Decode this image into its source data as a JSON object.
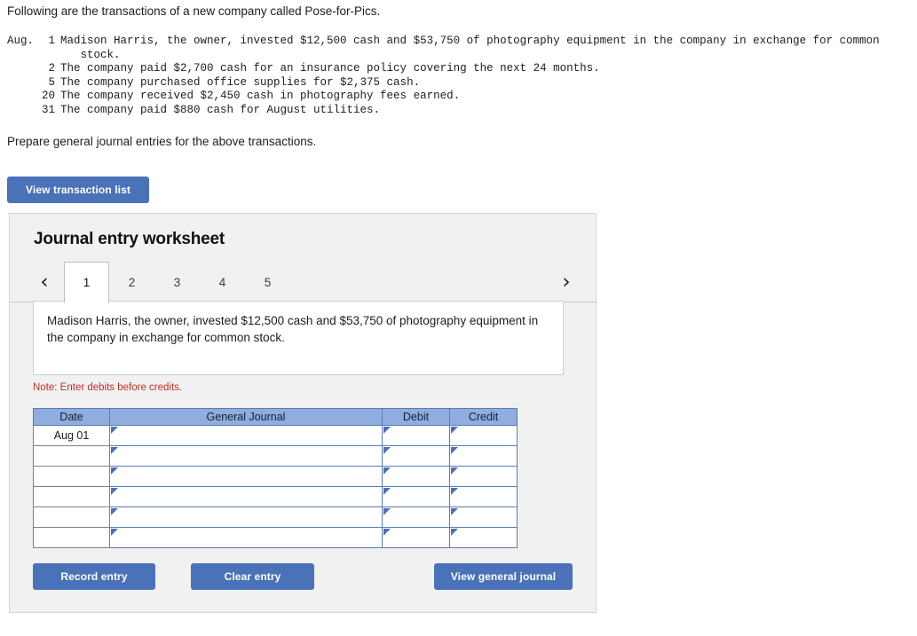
{
  "problem": {
    "intro": "Following are the transactions of a new company called Pose-for-Pics.",
    "month_label": "Aug.",
    "transactions": [
      {
        "day": "1",
        "description": "Madison Harris, the owner, invested $12,500 cash and $53,750 of photography equipment in the company in exchange for common\n   stock."
      },
      {
        "day": "2",
        "description": "The company paid $2,700 cash for an insurance policy covering the next 24 months."
      },
      {
        "day": "5",
        "description": "The company purchased office supplies for $2,375 cash."
      },
      {
        "day": "20",
        "description": "The company received $2,450 cash in photography fees earned."
      },
      {
        "day": "31",
        "description": "The company paid $880 cash for August utilities."
      }
    ],
    "instruction": "Prepare general journal entries for the above transactions."
  },
  "toolbar": {
    "view_transaction_list_label": "View transaction list"
  },
  "worksheet": {
    "title": "Journal entry worksheet",
    "prev_icon": "chevron-left-icon",
    "next_icon": "chevron-right-icon",
    "prev_glyph": "‹",
    "next_glyph": "›",
    "tabs": [
      {
        "label": "1",
        "active": true
      },
      {
        "label": "2",
        "active": false
      },
      {
        "label": "3",
        "active": false
      },
      {
        "label": "4",
        "active": false
      },
      {
        "label": "5",
        "active": false
      }
    ],
    "active_tab": "1",
    "entry_description": "Madison Harris, the owner, invested $12,500 cash and $53,750 of photography equipment in the company in exchange for common stock.",
    "note": "Note: Enter debits before credits.",
    "table": {
      "columns": [
        "Date",
        "General Journal",
        "Debit",
        "Credit"
      ],
      "rows": [
        {
          "date": "Aug 01",
          "general_journal": "",
          "debit": "",
          "credit": ""
        },
        {
          "date": "",
          "general_journal": "",
          "debit": "",
          "credit": ""
        },
        {
          "date": "",
          "general_journal": "",
          "debit": "",
          "credit": ""
        },
        {
          "date": "",
          "general_journal": "",
          "debit": "",
          "credit": ""
        },
        {
          "date": "",
          "general_journal": "",
          "debit": "",
          "credit": ""
        },
        {
          "date": "",
          "general_journal": "",
          "debit": "",
          "credit": ""
        }
      ]
    },
    "actions": {
      "record_entry_label": "Record entry",
      "clear_entry_label": "Clear entry",
      "view_general_journal_label": "View general journal"
    }
  },
  "colors": {
    "button_blue": "#4a72b8",
    "table_header_blue": "#8fadde",
    "table_border_blue": "#5b7bb5",
    "note_red": "#bd3026",
    "panel_gray": "#f1f1f1"
  }
}
